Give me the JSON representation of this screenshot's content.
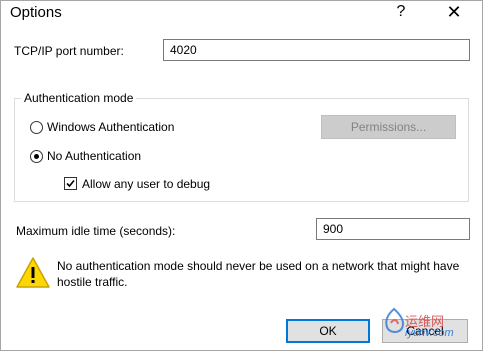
{
  "window": {
    "title": "Options",
    "help_glyph": "?",
    "close_glyph": "✕"
  },
  "port": {
    "label": "TCP/IP port number:",
    "value": "4020"
  },
  "auth": {
    "group_label": "Authentication mode",
    "windows_label": "Windows Authentication",
    "windows_selected": false,
    "permissions_label": "Permissions...",
    "none_label": "No Authentication",
    "none_selected": true,
    "allow_debug_label": "Allow any user to debug",
    "allow_debug_checked": true
  },
  "idle": {
    "label": "Maximum idle time (seconds):",
    "value": "900"
  },
  "warning": {
    "icon": "warning-icon",
    "text": "No authentication mode should never be used on a network that might have hostile traffic."
  },
  "buttons": {
    "ok": "OK",
    "cancel": "Cancel"
  },
  "watermark": {
    "line1": "运维网",
    "line2": "iyunv.com"
  },
  "colors": {
    "focus": "#0078d7",
    "warning_fill": "#ffd700",
    "disabled_button": "#cccccc"
  }
}
